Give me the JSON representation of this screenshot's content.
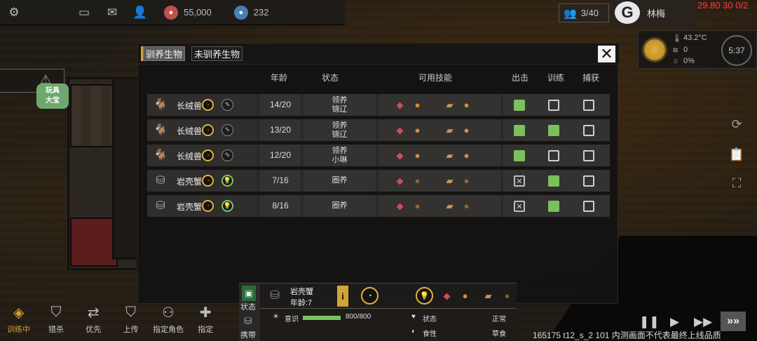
{
  "topbar": {
    "icons": [
      "gear-icon",
      "chat-icon",
      "mail-icon",
      "friend-icon"
    ],
    "coins": "55,000",
    "gears": "232"
  },
  "population": "3/40",
  "player": {
    "logo": "G",
    "name": "林梅"
  },
  "debug": "29.80 30 0/2",
  "weather": {
    "temp": "43.2°C",
    "wind": "0",
    "rain": "0%",
    "clock": "5:37"
  },
  "toybox": "玩具\n大宝",
  "panel": {
    "tabs": [
      "驯养生物",
      "未驯养生物"
    ],
    "close": "✕",
    "headers": {
      "age": "年龄",
      "state": "状态",
      "skills": "可用技能",
      "attack": "出击",
      "train": "训练",
      "capture": "捕获"
    },
    "rows": [
      {
        "icon": "goat-icon",
        "name": "长绒兽",
        "sub": "pencil",
        "age": "14/20",
        "state": "领养\n锦辽",
        "attack": "on",
        "train": "off",
        "capture": "off",
        "dim": false
      },
      {
        "icon": "goat-icon",
        "name": "长绒兽",
        "sub": "pencil",
        "age": "13/20",
        "state": "领养\n锦辽",
        "attack": "on",
        "train": "on",
        "capture": "off",
        "dim": false
      },
      {
        "icon": "goat-icon",
        "name": "长绒兽",
        "sub": "pencil",
        "age": "12/20",
        "state": "领养\n小琳",
        "attack": "on",
        "train": "off",
        "capture": "off",
        "dim": false
      },
      {
        "icon": "crab-icon",
        "name": "岩壳蟹",
        "sub": "bulb",
        "age": "7/16",
        "state": "圈养",
        "attack": "x",
        "train": "on",
        "capture": "off",
        "dim": true
      },
      {
        "icon": "crab-icon",
        "name": "岩壳蟹",
        "sub": "bulb",
        "age": "8/16",
        "state": "圈养",
        "attack": "x",
        "train": "on",
        "capture": "off",
        "dim": true
      }
    ]
  },
  "info": {
    "side_labels": [
      "状态",
      "携带"
    ],
    "name": "岩壳蟹",
    "age": "年龄:7",
    "awareness_label": "意识",
    "awareness_value": "800/800",
    "awareness_fraction": 1.0,
    "status_label": "状态",
    "status_value": "正常",
    "diet_label": "食性",
    "diet_value": "草食"
  },
  "bottombar": [
    {
      "label": "训练中",
      "icon": "sign-icon",
      "active": true
    },
    {
      "label": "猎杀",
      "icon": "hunt-icon",
      "active": false
    },
    {
      "label": "优先",
      "icon": "priority-icon",
      "active": false
    },
    {
      "label": "上传",
      "icon": "upload-icon",
      "active": false
    },
    {
      "label": "指定角色",
      "icon": "assign-role-icon",
      "active": false
    },
    {
      "label": "指定",
      "icon": "assign-icon",
      "active": false
    }
  ],
  "build_info": "165175 t12_s_2 101  内测画面不代表最终上线品质",
  "colors": {
    "accent": "#d2a437",
    "check_on": "#7cbf5e",
    "debug": "#ff3b3b"
  }
}
